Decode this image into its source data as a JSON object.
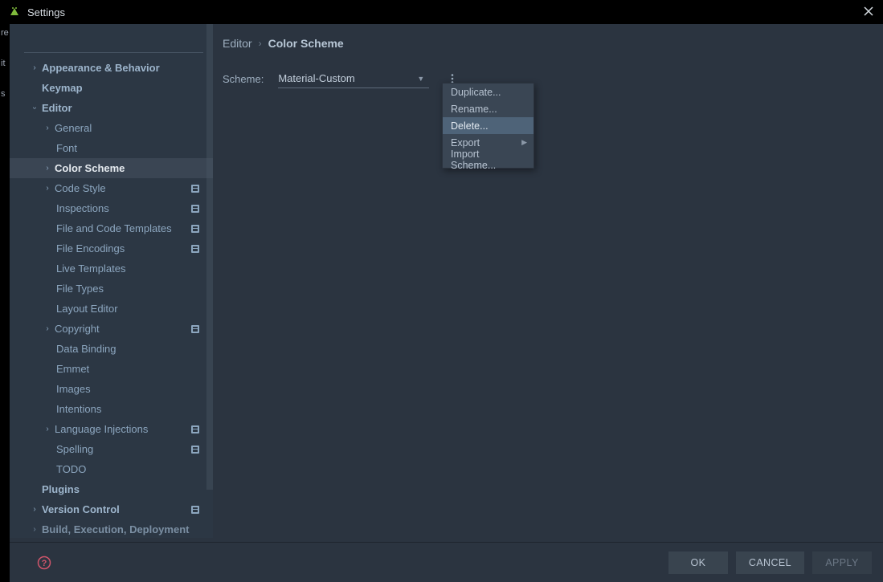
{
  "window": {
    "title": "Settings"
  },
  "leftStrip": {
    "t0": "re",
    "t1": "it",
    "t2": "s"
  },
  "breadcrumb": {
    "parent": "Editor",
    "current": "Color Scheme"
  },
  "scheme": {
    "label": "Scheme:",
    "value": "Material-Custom"
  },
  "popup": {
    "duplicate": "Duplicate...",
    "rename": "Rename...",
    "delete": "Delete...",
    "export": "Export",
    "import": "Import Scheme..."
  },
  "buttons": {
    "ok": "OK",
    "cancel": "CANCEL",
    "apply": "APPLY"
  },
  "tree": {
    "appearance": "Appearance & Behavior",
    "keymap": "Keymap",
    "editor": "Editor",
    "general": "General",
    "font": "Font",
    "colorScheme": "Color Scheme",
    "codeStyle": "Code Style",
    "inspections": "Inspections",
    "fileCodeTemplates": "File and Code Templates",
    "fileEncodings": "File Encodings",
    "liveTemplates": "Live Templates",
    "fileTypes": "File Types",
    "layoutEditor": "Layout Editor",
    "copyright": "Copyright",
    "dataBinding": "Data Binding",
    "emmet": "Emmet",
    "images": "Images",
    "intentions": "Intentions",
    "languageInjections": "Language Injections",
    "spelling": "Spelling",
    "todo": "TODO",
    "plugins": "Plugins",
    "versionControl": "Version Control",
    "build": "Build, Execution, Deployment"
  }
}
